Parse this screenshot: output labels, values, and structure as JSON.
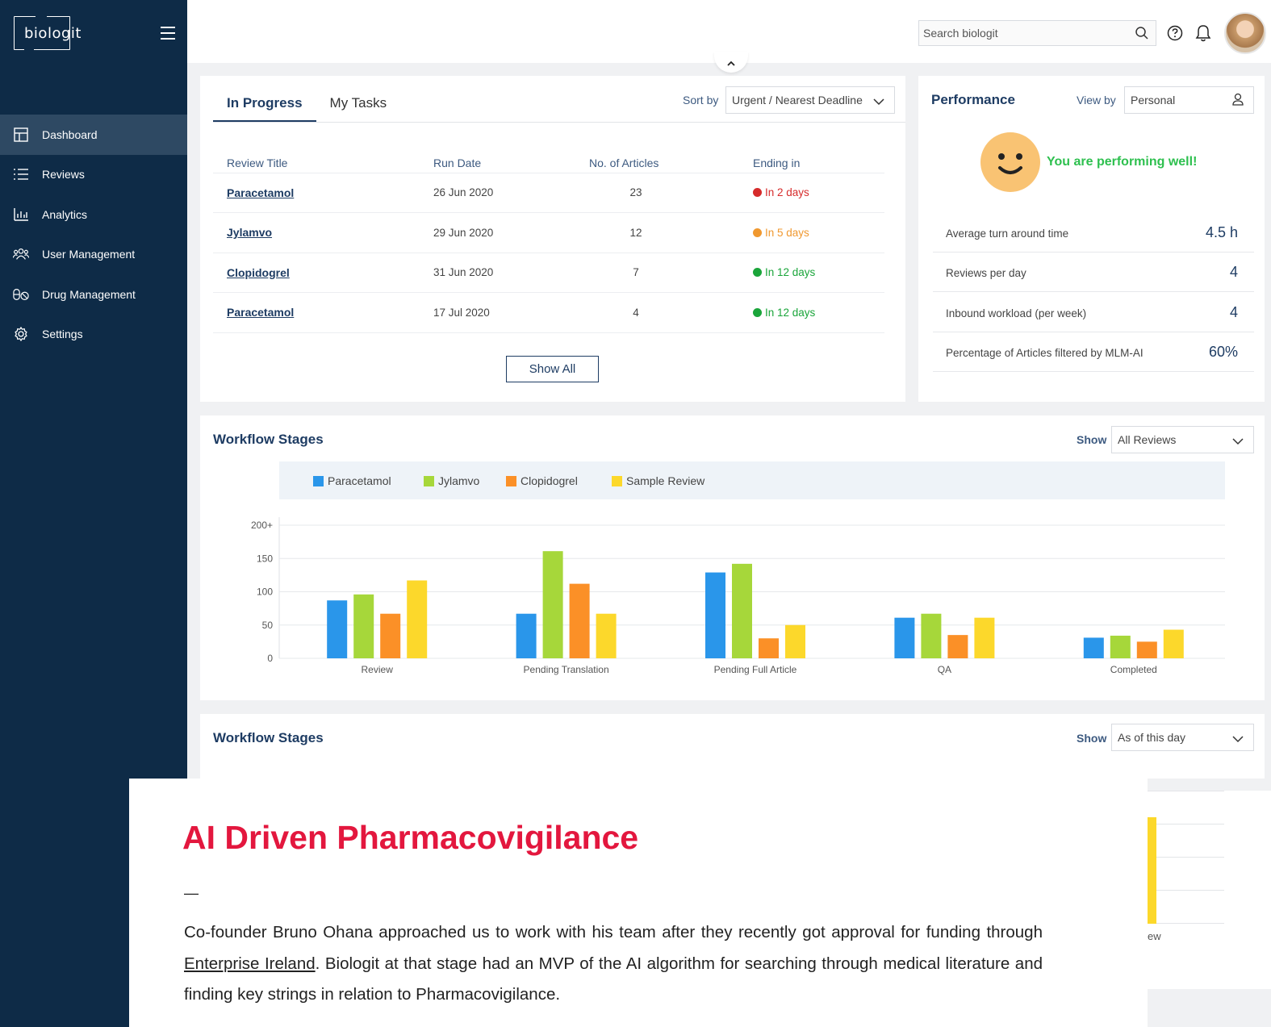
{
  "brand": {
    "logo_text": "biologit"
  },
  "sidebar": {
    "items": [
      {
        "label": "Dashboard",
        "icon": "grid-icon",
        "active": true
      },
      {
        "label": "Reviews",
        "icon": "list-icon",
        "active": false
      },
      {
        "label": "Analytics",
        "icon": "bar-chart-icon",
        "active": false
      },
      {
        "label": "User Management",
        "icon": "users-icon",
        "active": false
      },
      {
        "label": "Drug Management",
        "icon": "pills-icon",
        "active": false
      },
      {
        "label": "Settings",
        "icon": "gear-icon",
        "active": false
      }
    ]
  },
  "header": {
    "search_placeholder": "Search biologit"
  },
  "tasks": {
    "tabs": [
      "In Progress",
      "My Tasks"
    ],
    "sort_label": "Sort by",
    "sort_value": "Urgent / Nearest Deadline",
    "columns": [
      "Review Title",
      "Run Date",
      "No. of Articles",
      "Ending in"
    ],
    "rows": [
      {
        "title": "Paracetamol",
        "run_date": "26 Jun 2020",
        "articles": "23",
        "ending": "In 2 days",
        "status_color": "#d62b2b"
      },
      {
        "title": "Jylamvo",
        "run_date": "29 Jun 2020",
        "articles": "12",
        "ending": "In 5 days",
        "status_color": "#f0982f"
      },
      {
        "title": "Clopidogrel",
        "run_date": "31 Jun 2020",
        "articles": "7",
        "ending": "In 12 days",
        "status_color": "#1aa53a"
      },
      {
        "title": "Paracetamol",
        "run_date": "17 Jul 2020",
        "articles": "4",
        "ending": "In 12 days",
        "status_color": "#1aa53a"
      }
    ],
    "show_all_label": "Show All"
  },
  "performance": {
    "title": "Performance",
    "view_by_label": "View by",
    "view_by_value": "Personal",
    "message": "You are performing well!",
    "metrics": [
      {
        "name": "Average turn around time",
        "value": "4.5 h"
      },
      {
        "name": "Reviews per day",
        "value": "4"
      },
      {
        "name": "Inbound workload (per week)",
        "value": "4"
      },
      {
        "name": "Percentage of Articles filtered by MLM-AI",
        "value": "60%"
      }
    ]
  },
  "workflow1": {
    "title": "Workflow Stages",
    "show_label": "Show",
    "show_value": "All Reviews"
  },
  "workflow2": {
    "title": "Workflow Stages",
    "show_label": "Show",
    "show_value": "As of this day",
    "peek_label": "ew"
  },
  "chart_data": {
    "type": "bar",
    "categories": [
      "Review",
      "Pending Translation",
      "Pending Full Article",
      "QA",
      "Completed"
    ],
    "series": [
      {
        "name": "Paracetamol",
        "color": "#2a96ea",
        "values": [
          87,
          67,
          129,
          61,
          31
        ]
      },
      {
        "name": "Jylamvo",
        "color": "#a6d73a",
        "values": [
          96,
          161,
          142,
          67,
          34
        ]
      },
      {
        "name": "Clopidogrel",
        "color": "#fb9027",
        "values": [
          67,
          112,
          30,
          35,
          25
        ]
      },
      {
        "name": "Sample Review",
        "color": "#fcd82b",
        "values": [
          117,
          67,
          50,
          61,
          43
        ]
      }
    ],
    "yticks": [
      "0",
      "50",
      "100",
      "150",
      "200+"
    ],
    "ylim": [
      0,
      200
    ],
    "grid": true,
    "legend": "top"
  },
  "overlay": {
    "title": "AI Driven Pharmacovigilance",
    "dash": "—",
    "text_before_link": "Co-founder Bruno Ohana approached us to work with his team after they recently got approval for funding through ",
    "link_text": "Enterprise Ireland",
    "text_after_link": ". Biologit at that stage had an MVP of the AI algorithm for searching through medical literature and finding key strings in relation to Pharmacovigilance."
  }
}
